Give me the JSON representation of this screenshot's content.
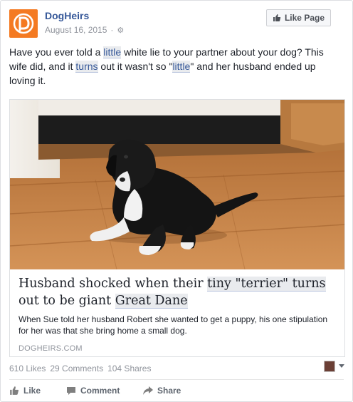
{
  "header": {
    "page_name": "DogHeirs",
    "date": "August 16, 2015",
    "separator": "·",
    "like_page_label": "Like Page"
  },
  "post": {
    "text_parts": {
      "p1": "Have you ever told a ",
      "h1": "little",
      "p2": " white lie to your partner about your dog? This wife did, and it ",
      "h2": "turns",
      "p3": " out it wasn't so \"",
      "h3": "little",
      "p4": "\" and her husband ended up loving it."
    }
  },
  "link": {
    "title_p1": "Husband shocked when their ",
    "title_h1": "tiny \"terrier\" turns",
    "title_p2": " out to be giant ",
    "title_h2": "Great Dane",
    "description": "When Sue told her husband Robert she wanted to get a puppy, his one stipulation for her was that she bring home a small dog.",
    "domain": "DOGHEIRS.COM"
  },
  "stats": {
    "likes": "610 Likes",
    "comments": "29 Comments",
    "shares": "104 Shares"
  },
  "actions": {
    "like": "Like",
    "comment": "Comment",
    "share": "Share"
  },
  "colors": {
    "brand_orange": "#f47a22",
    "link_blue": "#365899",
    "muted_gray": "#90949c"
  }
}
